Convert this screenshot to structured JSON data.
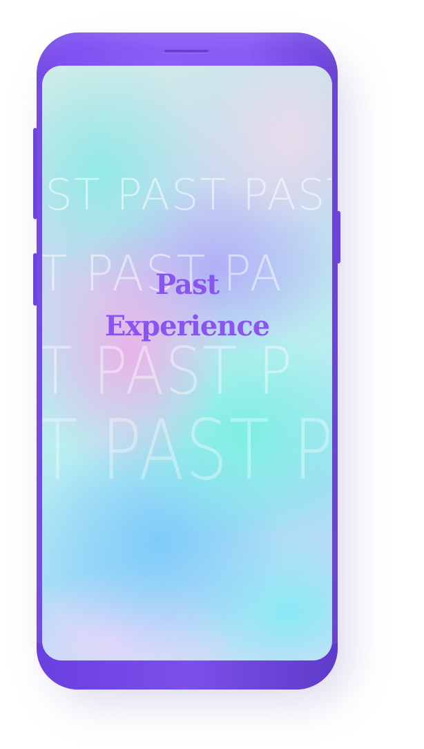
{
  "screen": {
    "watermark_word": "PAST",
    "watermark_rows": [
      "AST PAST PAST",
      "ST PAST PA",
      "ST PAST P",
      "ST PAST PA"
    ],
    "title_line1": "Past",
    "title_line2": "Experience"
  },
  "colors": {
    "phone_body": "#8b5cf6",
    "title_text": "#8a55ee"
  }
}
